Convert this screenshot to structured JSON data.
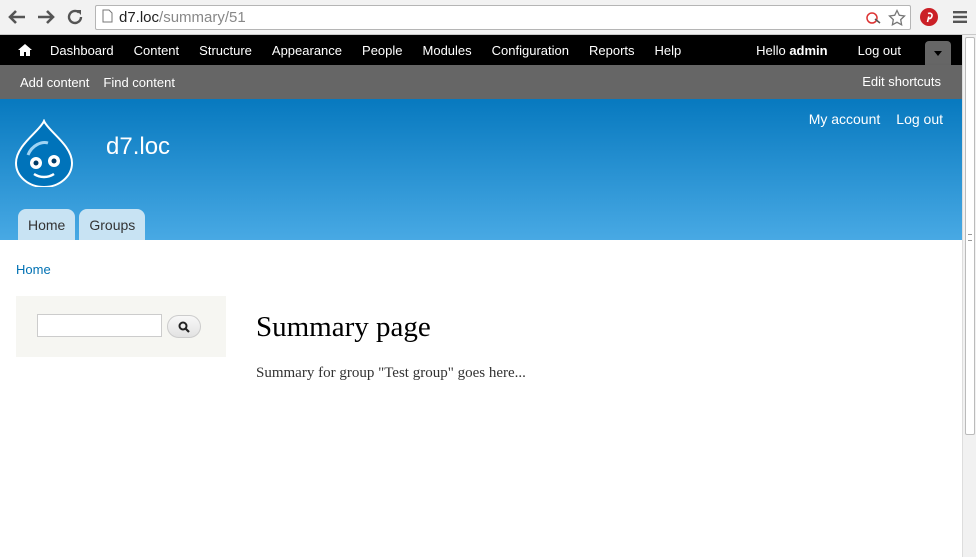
{
  "browser": {
    "url_host": "d7.loc",
    "url_path": "/summary/51"
  },
  "toolbar": {
    "items": [
      "Dashboard",
      "Content",
      "Structure",
      "Appearance",
      "People",
      "Modules",
      "Configuration",
      "Reports",
      "Help"
    ],
    "hello_prefix": "Hello ",
    "username": "admin",
    "logout": "Log out"
  },
  "shortcuts": {
    "items": [
      "Add content",
      "Find content"
    ],
    "edit": "Edit shortcuts"
  },
  "header": {
    "site_name": "d7.loc",
    "secondary": [
      "My account",
      "Log out"
    ],
    "tabs": [
      "Home",
      "Groups"
    ]
  },
  "content": {
    "breadcrumb": "Home",
    "title": "Summary page",
    "body": "Summary for group \"Test group\" goes here..."
  },
  "colors": {
    "toolbar_bg": "#000000",
    "shortcuts_bg": "#666666",
    "header_top": "#0779bf",
    "header_bottom": "#48a9e4",
    "link": "#0071b3"
  }
}
